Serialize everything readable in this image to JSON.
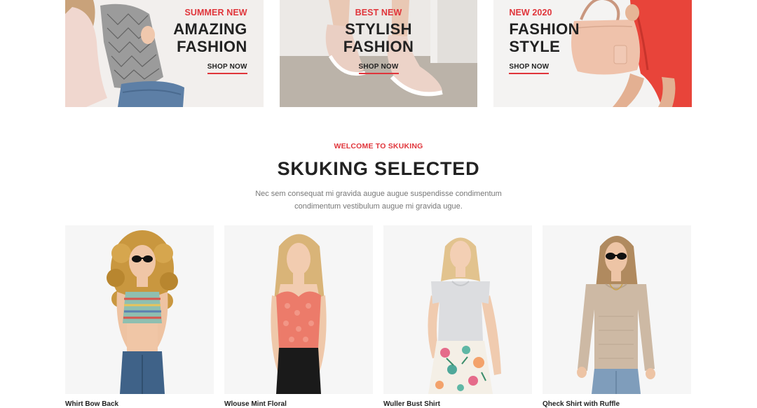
{
  "banners": [
    {
      "kicker": "SUMMER NEW",
      "title_line1": "AMAZING",
      "title_line2": "FASHION",
      "link": "SHOP NOW"
    },
    {
      "kicker": "BEST NEW",
      "title_line1": "STYLISH",
      "title_line2": "FASHION",
      "link": "SHOP NOW"
    },
    {
      "kicker": "NEW 2020",
      "title_line1": "FASHION",
      "title_line2": "STYLE",
      "link": "SHOP NOW"
    }
  ],
  "section": {
    "kicker": "WELCOME TO SKUKING",
    "title": "SKUKING SELECTED",
    "desc_line1": "Nec sem consequat mi gravida augue augue suspendisse condimentum",
    "desc_line2": "condimentum vestibulum augue mi gravida ugue."
  },
  "products": [
    {
      "name": "Whirt Bow Back"
    },
    {
      "name": "Wlouse Mint Floral"
    },
    {
      "name": "Wuller Bust Shirt"
    },
    {
      "name": "Qheck Shirt with Ruffle"
    }
  ],
  "colors": {
    "accent": "#e0353b",
    "heading": "#222222",
    "body_text": "#777777",
    "card_bg": "#f6f6f6"
  }
}
